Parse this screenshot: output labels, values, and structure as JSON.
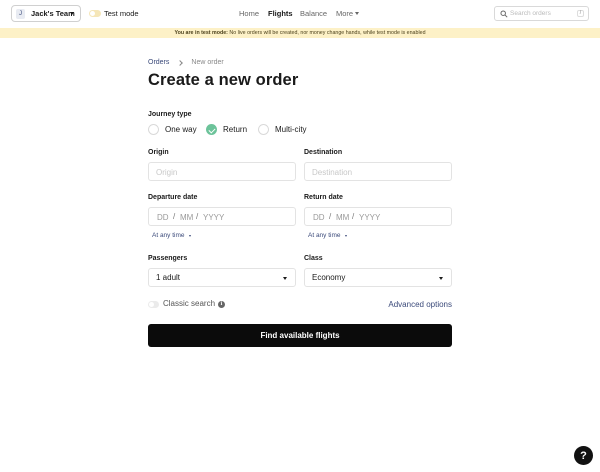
{
  "header": {
    "team": {
      "initial": "J",
      "name": "Jack's Team"
    },
    "test_mode_label": "Test mode",
    "nav": {
      "home": "Home",
      "flights": "Flights",
      "balance": "Balance",
      "more": "More"
    },
    "search": {
      "placeholder": "Search orders",
      "shortcut": "/"
    }
  },
  "banner": {
    "prefix": "You are in test mode:",
    "text": "No live orders will be created, nor money change hands, while test mode is enabled"
  },
  "breadcrumb": {
    "orders": "Orders",
    "current": "New order"
  },
  "page_title": "Create a new order",
  "journey": {
    "label": "Journey type",
    "options": [
      "One way",
      "Return",
      "Multi-city"
    ],
    "selected": "Return"
  },
  "origin": {
    "label": "Origin",
    "placeholder": "Origin"
  },
  "destination": {
    "label": "Destination",
    "placeholder": "Destination"
  },
  "departure": {
    "label": "Departure date",
    "dd": "DD",
    "mm": "MM",
    "yyyy": "YYYY",
    "time": "At any time"
  },
  "return_date": {
    "label": "Return date",
    "dd": "DD",
    "mm": "MM",
    "yyyy": "YYYY",
    "time": "At any time"
  },
  "passengers": {
    "label": "Passengers",
    "value": "1 adult"
  },
  "class": {
    "label": "Class",
    "value": "Economy"
  },
  "classic_search": {
    "label": "Classic search",
    "enabled": false
  },
  "advanced_options": "Advanced options",
  "submit": "Find available flights",
  "help": "?",
  "colors": {
    "banner_bg": "#fdf1c7",
    "link": "#3b4a7a",
    "radio_checked": "#6cc39a",
    "primary_button": "#0b0b0b"
  }
}
